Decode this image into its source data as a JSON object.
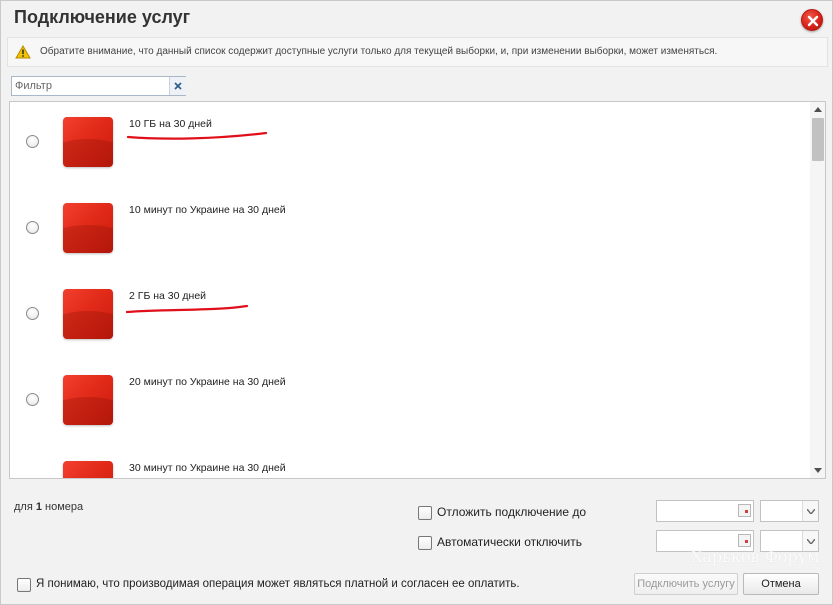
{
  "dialog": {
    "title": "Подключение услуг"
  },
  "warning": {
    "text": "Обратите внимание, что данный список содержит доступные услуги только для текущей выборки, и, при изменении выборки, может изменяться."
  },
  "filter": {
    "placeholder": "Фильтр",
    "value": ""
  },
  "services": [
    {
      "label": "10 ГБ на 30 дней",
      "underlined": true,
      "selected": false
    },
    {
      "label": "10 минут по Украине на 30 дней",
      "underlined": false,
      "selected": false
    },
    {
      "label": "2 ГБ на 30 дней",
      "underlined": true,
      "selected": false
    },
    {
      "label": "20 минут по Украине на 30 дней",
      "underlined": false,
      "selected": false
    },
    {
      "label": "30 минут по Украине на 30 дней",
      "underlined": false,
      "selected": false
    }
  ],
  "footer": {
    "count_prefix": "для ",
    "count_value": "1",
    "count_suffix": " номера",
    "postpone_label": "Отложить подключение до",
    "postpone_date": "",
    "postpone_time": "",
    "autooff_label": "Автоматически отключить",
    "autooff_date": "",
    "autooff_time": "",
    "agree_label": "Я понимаю, что производимая операция может являться платной и согласен ее оплатить.",
    "connect_button": "Подключить услугу",
    "cancel_button": "Отмена"
  },
  "watermark": "Харьков Форум",
  "colors": {
    "accent_red": "#e22a19",
    "underline_red": "#e0101a",
    "warning_yellow": "#f2c200"
  },
  "icons": {
    "close": "close-icon",
    "warning": "warning-icon",
    "clear": "clear-filter-icon",
    "calendar": "calendar-icon",
    "dropdown": "chevron-down-icon"
  }
}
